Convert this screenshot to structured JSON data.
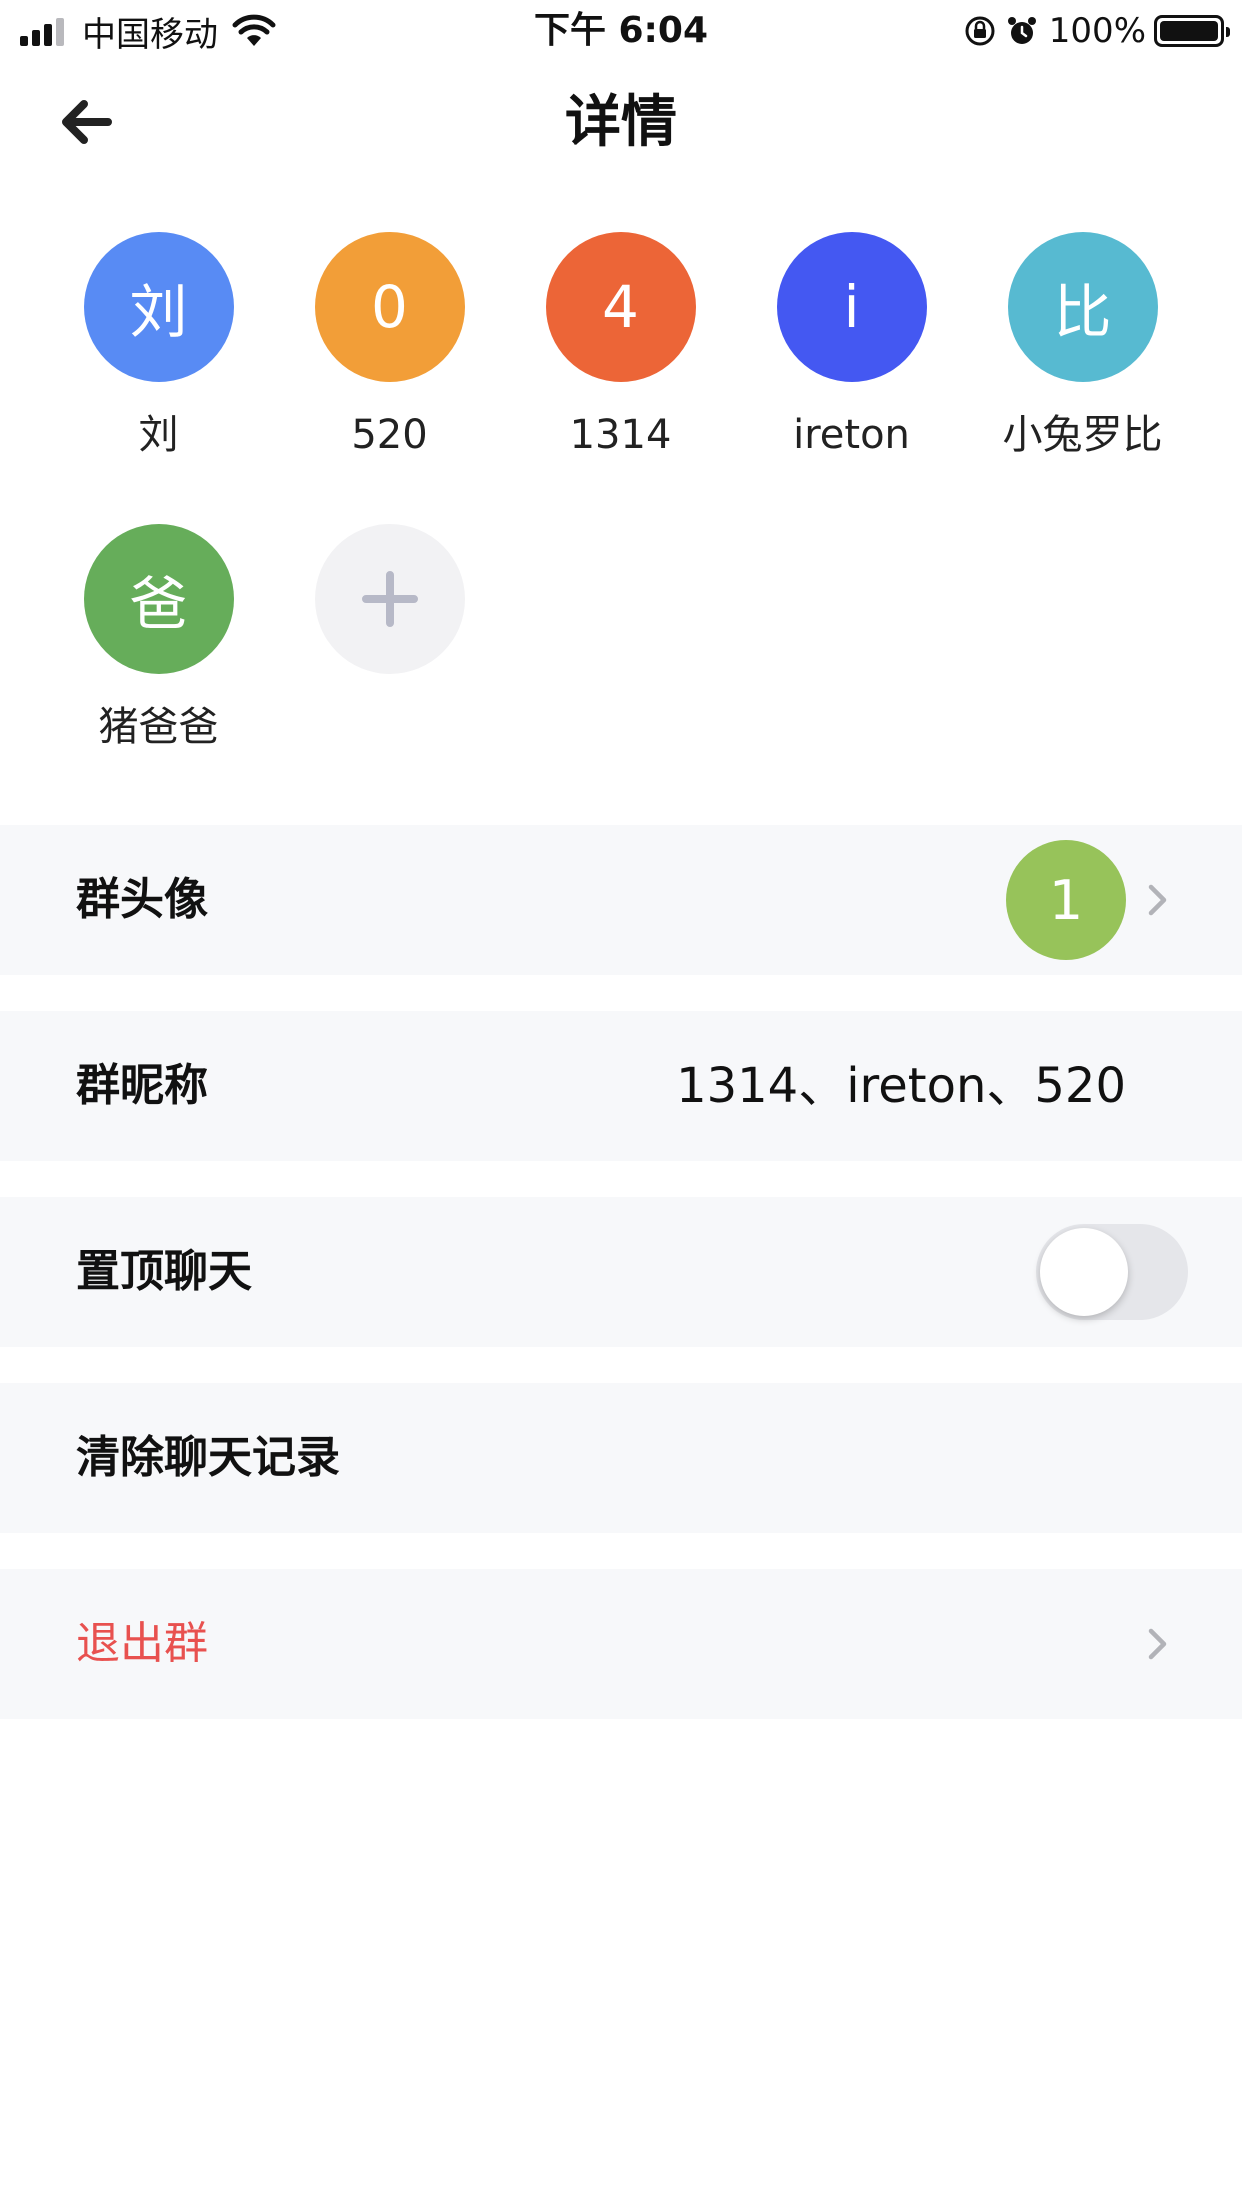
{
  "status_bar": {
    "carrier": "中国移动",
    "time": "下午 6:04",
    "battery": "100%"
  },
  "header": {
    "title": "详情"
  },
  "members": [
    {
      "avatar_text": "刘",
      "name": "刘",
      "color": "#588bf4"
    },
    {
      "avatar_text": "0",
      "name": "520",
      "color": "#f29e38"
    },
    {
      "avatar_text": "4",
      "name": "1314",
      "color": "#ec6537"
    },
    {
      "avatar_text": "i",
      "name": "ireton",
      "color": "#4458f2"
    },
    {
      "avatar_text": "比",
      "name": "小兔罗比",
      "color": "#57bad1"
    },
    {
      "avatar_text": "爸",
      "name": "猪爸爸",
      "color": "#66ad5a"
    }
  ],
  "settings": {
    "group_avatar": {
      "label": "群头像",
      "value": "1",
      "color": "#97c35a"
    },
    "group_nickname": {
      "label": "群昵称",
      "value": "1314、ireton、520"
    },
    "pin_chat": {
      "label": "置顶聊天",
      "enabled": false
    },
    "clear_history": {
      "label": "清除聊天记录"
    },
    "leave_group": {
      "label": "退出群",
      "color": "#e8514f"
    }
  }
}
